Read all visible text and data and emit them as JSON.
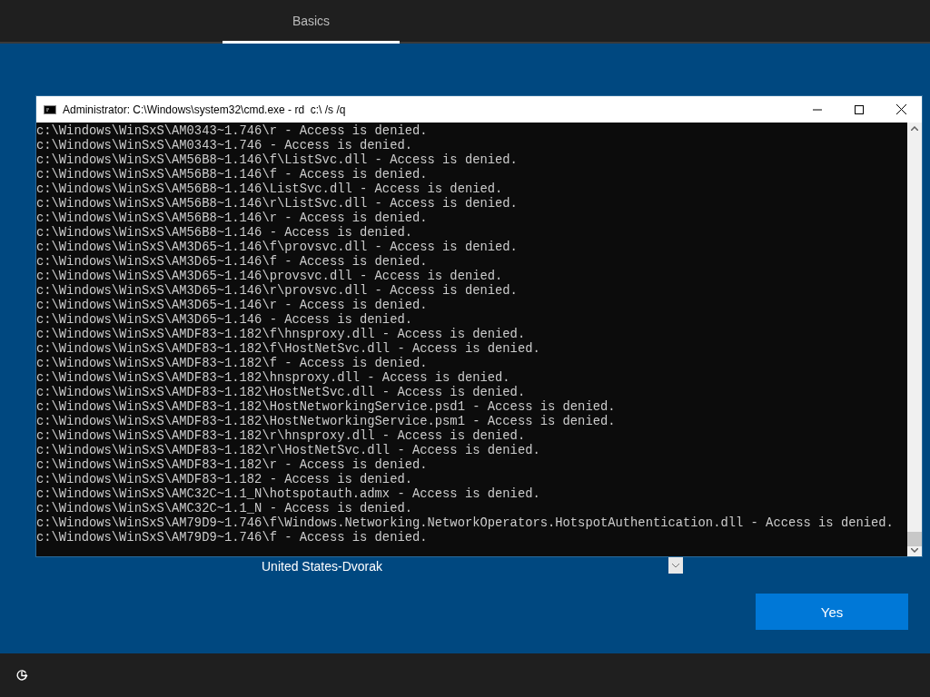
{
  "header": {
    "tabs": [
      {
        "label": "Basics",
        "selected": true
      }
    ]
  },
  "console": {
    "title": "Administrator: C:\\Windows\\system32\\cmd.exe - rd  c:\\ /s /q",
    "lines": [
      "c:\\Windows\\WinSxS\\AM0343~1.746\\r - Access is denied.",
      "c:\\Windows\\WinSxS\\AM0343~1.746 - Access is denied.",
      "c:\\Windows\\WinSxS\\AM56B8~1.146\\f\\ListSvc.dll - Access is denied.",
      "c:\\Windows\\WinSxS\\AM56B8~1.146\\f - Access is denied.",
      "c:\\Windows\\WinSxS\\AM56B8~1.146\\ListSvc.dll - Access is denied.",
      "c:\\Windows\\WinSxS\\AM56B8~1.146\\r\\ListSvc.dll - Access is denied.",
      "c:\\Windows\\WinSxS\\AM56B8~1.146\\r - Access is denied.",
      "c:\\Windows\\WinSxS\\AM56B8~1.146 - Access is denied.",
      "c:\\Windows\\WinSxS\\AM3D65~1.146\\f\\provsvc.dll - Access is denied.",
      "c:\\Windows\\WinSxS\\AM3D65~1.146\\f - Access is denied.",
      "c:\\Windows\\WinSxS\\AM3D65~1.146\\provsvc.dll - Access is denied.",
      "c:\\Windows\\WinSxS\\AM3D65~1.146\\r\\provsvc.dll - Access is denied.",
      "c:\\Windows\\WinSxS\\AM3D65~1.146\\r - Access is denied.",
      "c:\\Windows\\WinSxS\\AM3D65~1.146 - Access is denied.",
      "c:\\Windows\\WinSxS\\AMDF83~1.182\\f\\hnsproxy.dll - Access is denied.",
      "c:\\Windows\\WinSxS\\AMDF83~1.182\\f\\HostNetSvc.dll - Access is denied.",
      "c:\\Windows\\WinSxS\\AMDF83~1.182\\f - Access is denied.",
      "c:\\Windows\\WinSxS\\AMDF83~1.182\\hnsproxy.dll - Access is denied.",
      "c:\\Windows\\WinSxS\\AMDF83~1.182\\HostNetSvc.dll - Access is denied.",
      "c:\\Windows\\WinSxS\\AMDF83~1.182\\HostNetworkingService.psd1 - Access is denied.",
      "c:\\Windows\\WinSxS\\AMDF83~1.182\\HostNetworkingService.psm1 - Access is denied.",
      "c:\\Windows\\WinSxS\\AMDF83~1.182\\r\\hnsproxy.dll - Access is denied.",
      "c:\\Windows\\WinSxS\\AMDF83~1.182\\r\\HostNetSvc.dll - Access is denied.",
      "c:\\Windows\\WinSxS\\AMDF83~1.182\\r - Access is denied.",
      "c:\\Windows\\WinSxS\\AMDF83~1.182 - Access is denied.",
      "c:\\Windows\\WinSxS\\AMC32C~1.1_N\\hotspotauth.admx - Access is denied.",
      "c:\\Windows\\WinSxS\\AMC32C~1.1_N - Access is denied.",
      "c:\\Windows\\WinSxS\\AM79D9~1.746\\f\\Windows.Networking.NetworkOperators.HotspotAuthentication.dll - Access is denied.",
      "c:\\Windows\\WinSxS\\AM79D9~1.746\\f - Access is denied."
    ]
  },
  "layout_list": {
    "value": "United States-Dvorak"
  },
  "buttons": [
    {
      "label": "Yes"
    }
  ]
}
